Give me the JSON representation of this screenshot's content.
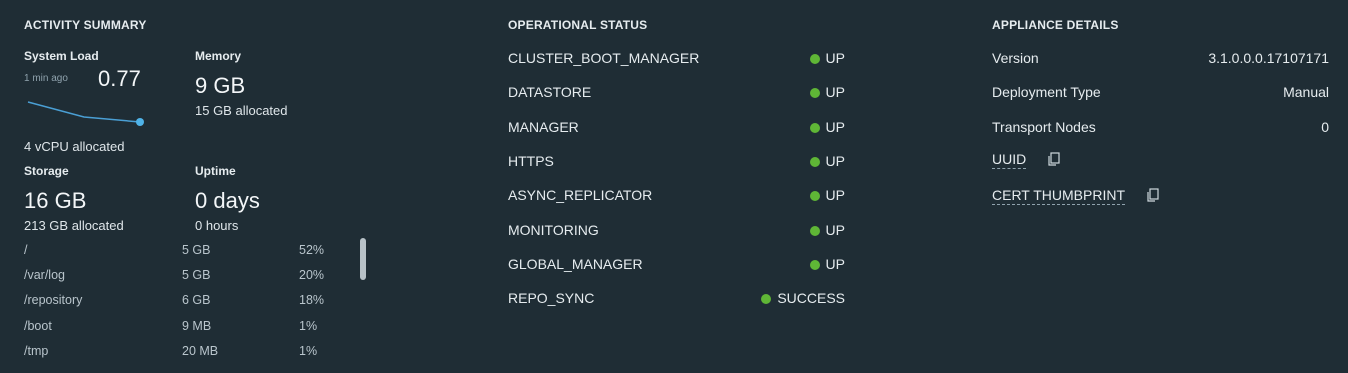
{
  "activity": {
    "title": "ACTIVITY SUMMARY",
    "system_load": {
      "label": "System Load",
      "time": "1 min ago",
      "value": "0.77",
      "sub": "4 vCPU allocated"
    },
    "memory": {
      "label": "Memory",
      "value": "9 GB",
      "sub": "15 GB allocated"
    },
    "storage": {
      "label": "Storage",
      "value": "16 GB",
      "sub": "213 GB allocated"
    },
    "uptime": {
      "label": "Uptime",
      "value": "0 days",
      "sub": "0 hours"
    },
    "disks": [
      {
        "name": "/",
        "size": "5 GB",
        "pct": "52%"
      },
      {
        "name": "/var/log",
        "size": "5 GB",
        "pct": "20%"
      },
      {
        "name": "/repository",
        "size": "6 GB",
        "pct": "18%"
      },
      {
        "name": "/boot",
        "size": "9 MB",
        "pct": "1%"
      },
      {
        "name": "/tmp",
        "size": "20 MB",
        "pct": "1%"
      }
    ]
  },
  "operational": {
    "title": "OPERATIONAL STATUS",
    "items": [
      {
        "name": "CLUSTER_BOOT_MANAGER",
        "status": "UP"
      },
      {
        "name": "DATASTORE",
        "status": "UP"
      },
      {
        "name": "MANAGER",
        "status": "UP"
      },
      {
        "name": "HTTPS",
        "status": "UP"
      },
      {
        "name": "ASYNC_REPLICATOR",
        "status": "UP"
      },
      {
        "name": "MONITORING",
        "status": "UP"
      },
      {
        "name": "GLOBAL_MANAGER",
        "status": "UP"
      },
      {
        "name": "REPO_SYNC",
        "status": "SUCCESS"
      }
    ],
    "status_color": "#5fb636"
  },
  "appliance": {
    "title": "APPLIANCE DETAILS",
    "version_label": "Version",
    "version_value": "3.1.0.0.0.17107171",
    "deployment_label": "Deployment Type",
    "deployment_value": "Manual",
    "transport_label": "Transport Nodes",
    "transport_value": "0",
    "uuid_label": "UUID",
    "cert_label": "CERT THUMBPRINT"
  }
}
